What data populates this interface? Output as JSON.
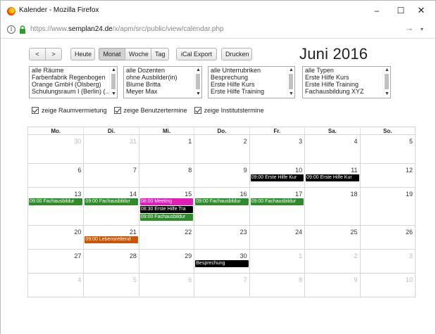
{
  "browser": {
    "title": "Kalender - Mozilla Firefox",
    "url_prefix": "https://www.",
    "url_domain": "semplan24.de",
    "url_path": "/x/apm/src/public/view/calendar.php",
    "minimize": "–",
    "maximize": "☐",
    "close": "✕",
    "info": "i",
    "pin": "⊸",
    "menu": "▾"
  },
  "toolbar": {
    "prev": "<",
    "next": ">",
    "today": "Heute",
    "views": [
      "Monat",
      "Woche",
      "Tag"
    ],
    "active_view": "Monat",
    "ical": "iCal Export",
    "print": "Drucken"
  },
  "month_title": "Juni 2016",
  "filters": {
    "rooms": [
      "alle Räume",
      "Farbenfabrik Regenbogen",
      "Orange GmbH (Olsberg)",
      "Schulungsraum I (Berlin) (..."
    ],
    "trainers": [
      "alle Dozenten",
      "ohne Ausbilder(in)",
      "Blume Britta",
      "Meyer Max"
    ],
    "subcategories": [
      "alle Unterrubriken",
      "Besprechung",
      "Erste Hilfe Kurs",
      "Erste Hilfe Training"
    ],
    "types": [
      "alle Typen",
      "Erste Hilfe Kurs",
      "Erste Hilfe Training",
      "Fachausbildung XYZ"
    ]
  },
  "checkboxes": {
    "rooms": "zeige Raumvermietung",
    "users": "zeige Benutzertermine",
    "institute": "zeige Institutstermine"
  },
  "weekdays": [
    "Mo.",
    "Di.",
    "Mi.",
    "Do.",
    "Fr.",
    "Sa.",
    "So."
  ],
  "weeks": [
    [
      {
        "day": "30",
        "other": true,
        "events": []
      },
      {
        "day": "31",
        "other": true,
        "events": []
      },
      {
        "day": "1",
        "events": []
      },
      {
        "day": "2",
        "events": []
      },
      {
        "day": "3",
        "events": []
      },
      {
        "day": "4",
        "events": []
      },
      {
        "day": "5",
        "events": []
      }
    ],
    [
      {
        "day": "6",
        "events": []
      },
      {
        "day": "7",
        "events": []
      },
      {
        "day": "8",
        "events": []
      },
      {
        "day": "9",
        "events": []
      },
      {
        "day": "10",
        "events": [
          {
            "text": "09:00 Erste Hilfe Kur",
            "color": "black"
          }
        ]
      },
      {
        "day": "11",
        "events": [
          {
            "text": "09:00 Erste Hilfe Kur",
            "color": "black"
          }
        ]
      },
      {
        "day": "12",
        "events": []
      }
    ],
    [
      {
        "day": "13",
        "events": [
          {
            "text": "09:00 Fachausbildur",
            "color": "green"
          }
        ]
      },
      {
        "day": "14",
        "events": [
          {
            "text": "09:00 Fachausbildur",
            "color": "green"
          }
        ]
      },
      {
        "day": "15",
        "events": [
          {
            "text": "08:00 Meeting",
            "color": "magenta"
          },
          {
            "text": "08:30 Erste Hilfe Tra",
            "color": "black"
          },
          {
            "text": "09:00 Fachausbildur",
            "color": "green"
          }
        ]
      },
      {
        "day": "16",
        "events": [
          {
            "text": "09:00 Fachausbildur",
            "color": "green"
          }
        ]
      },
      {
        "day": "17",
        "events": [
          {
            "text": "09:00 Fachausbildur",
            "color": "green"
          }
        ]
      },
      {
        "day": "18",
        "events": []
      },
      {
        "day": "19",
        "events": []
      }
    ],
    [
      {
        "day": "20",
        "events": []
      },
      {
        "day": "21",
        "events": [
          {
            "text": "09:00 Lebensrettend",
            "color": "orange"
          }
        ]
      },
      {
        "day": "22",
        "events": []
      },
      {
        "day": "23",
        "events": []
      },
      {
        "day": "24",
        "events": []
      },
      {
        "day": "25",
        "events": []
      },
      {
        "day": "26",
        "events": []
      }
    ],
    [
      {
        "day": "27",
        "events": []
      },
      {
        "day": "28",
        "events": []
      },
      {
        "day": "29",
        "events": []
      },
      {
        "day": "30",
        "events": [
          {
            "text": "Besprechung",
            "color": "black"
          }
        ]
      },
      {
        "day": "1",
        "other": true,
        "events": []
      },
      {
        "day": "2",
        "other": true,
        "events": []
      },
      {
        "day": "3",
        "other": true,
        "events": []
      }
    ],
    [
      {
        "day": "4",
        "other": true,
        "events": []
      },
      {
        "day": "5",
        "other": true,
        "events": []
      },
      {
        "day": "6",
        "other": true,
        "events": []
      },
      {
        "day": "7",
        "other": true,
        "events": []
      },
      {
        "day": "8",
        "other": true,
        "events": []
      },
      {
        "day": "9",
        "other": true,
        "events": []
      },
      {
        "day": "10",
        "other": true,
        "events": []
      }
    ]
  ],
  "colors": {
    "green": "#2e8b2e",
    "black": "#000000",
    "magenta": "#e11fb8",
    "orange": "#cc5500"
  }
}
